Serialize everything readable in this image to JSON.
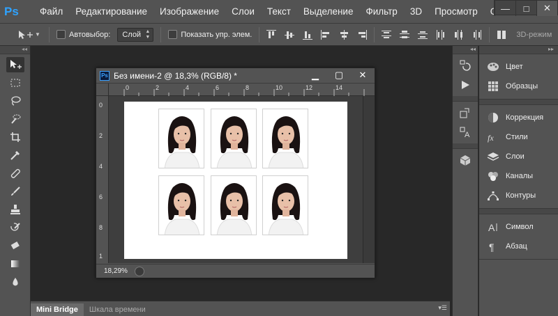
{
  "app": {
    "logo": "Ps",
    "menu": [
      "Файл",
      "Редактирование",
      "Изображение",
      "Слои",
      "Текст",
      "Выделение",
      "Фильтр",
      "3D",
      "Просмотр",
      "Окно"
    ],
    "window_controls": {
      "minimize": "—",
      "maximize": "□",
      "close": "✕"
    }
  },
  "options_bar": {
    "autoselect_label": "Автовыбор:",
    "autoselect_value": "Слой",
    "show_transform_label": "Показать упр. элем.",
    "mode_3d_label": "3D-режим"
  },
  "document": {
    "icon": "Ps",
    "title": "Без имени-2 @ 18,3% (RGB/8) *",
    "ruler_h": [
      "0",
      "2",
      "4",
      "6",
      "8",
      "10",
      "12",
      "14"
    ],
    "ruler_v": [
      "0",
      "2",
      "4",
      "6",
      "8",
      "1"
    ],
    "zoom": "18,29%",
    "photo_count": 6
  },
  "bottom_tabs": {
    "mini_bridge": "Mini Bridge",
    "timeline": "Шкала времени"
  },
  "right_panel": {
    "group1": [
      "Цвет",
      "Образцы"
    ],
    "group2": [
      "Коррекция",
      "Стили",
      "Слои",
      "Каналы",
      "Контуры"
    ],
    "group3": [
      "Символ",
      "Абзац"
    ]
  },
  "colors": {
    "ui_gray": "#535353",
    "workspace": "#282828",
    "ps_blue": "#2fa3ff"
  }
}
